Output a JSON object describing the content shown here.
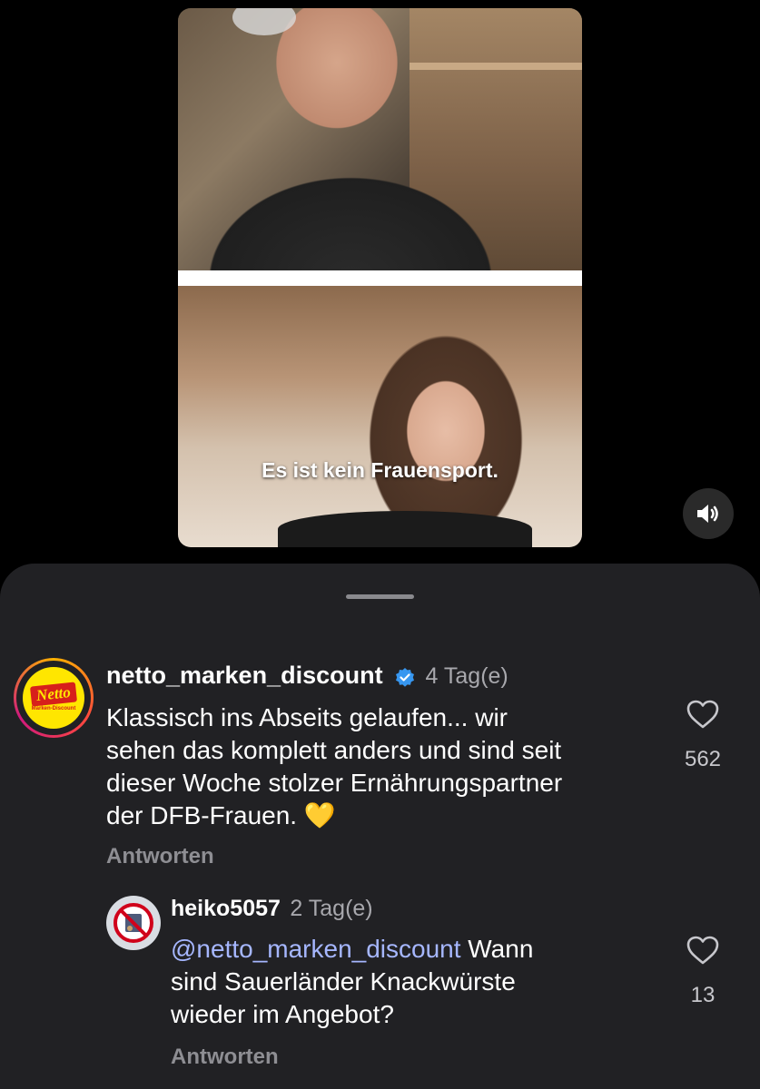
{
  "video": {
    "caption": "Es ist kein Frauensport."
  },
  "icons": {
    "sound": "speaker-volume-icon",
    "like": "heart-outline-icon",
    "verified": "verified-badge-icon"
  },
  "colors": {
    "sheet_background": "#212124",
    "mention": "#a6b7ff",
    "verified_blue": "#3797f0",
    "netto_yellow": "#ffe600",
    "netto_red": "#d7201b"
  },
  "comments": [
    {
      "username": "netto_marken_discount",
      "verified": true,
      "time": "4 Tag(e)",
      "avatar_logo_text": "Netto",
      "avatar_logo_subtext": "Marken-Discount",
      "lines": [
        "Klassisch ins Abseits gelaufen... wir",
        "sehen das komplett anders und sind seit",
        "dieser Woche stolzer Ernährungspartner",
        "der DFB-Frauen."
      ],
      "emoji": "💛",
      "likes": "562",
      "reply_label": "Antworten"
    },
    {
      "username": "heiko5057",
      "verified": false,
      "time": "2 Tag(e)",
      "mention": "@netto_marken_discount",
      "lines": [
        "Wann",
        "sind Sauerländer Knackwürste",
        "wieder im Angebot?"
      ],
      "likes": "13",
      "reply_label": "Antworten"
    }
  ]
}
